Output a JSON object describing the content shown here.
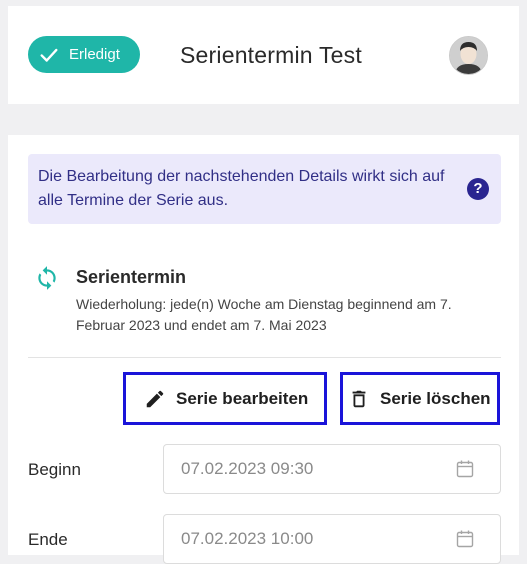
{
  "header": {
    "status_label": "Erledigt",
    "title": "Serientermin Test",
    "avatar_icon": "user-avatar",
    "status_color": "#1fb6a8"
  },
  "info_banner": {
    "text": "Die Bearbeitung der nachstehenden Details wirkt sich auf alle Termine der Serie aus.",
    "help_icon": "question-mark",
    "help_symbol": "?",
    "bg_color": "#ebe9fb"
  },
  "series": {
    "icon": "repeat-icon",
    "title": "Serientermin",
    "description": "Wiederholung: jede(n) Woche am Dienstag beginnend am 7. Februar 2023 und endet am 7. Mai 2023"
  },
  "actions": {
    "edit_label": "Serie bearbeiten",
    "delete_label": "Serie löschen",
    "edit_icon": "pencil-icon",
    "delete_icon": "trash-icon"
  },
  "fields": [
    {
      "label": "Beginn",
      "value": "07.02.2023 09:30",
      "icon": "calendar-icon"
    },
    {
      "label": "Ende",
      "value": "07.02.2023 10:00",
      "icon": "calendar-icon"
    }
  ]
}
